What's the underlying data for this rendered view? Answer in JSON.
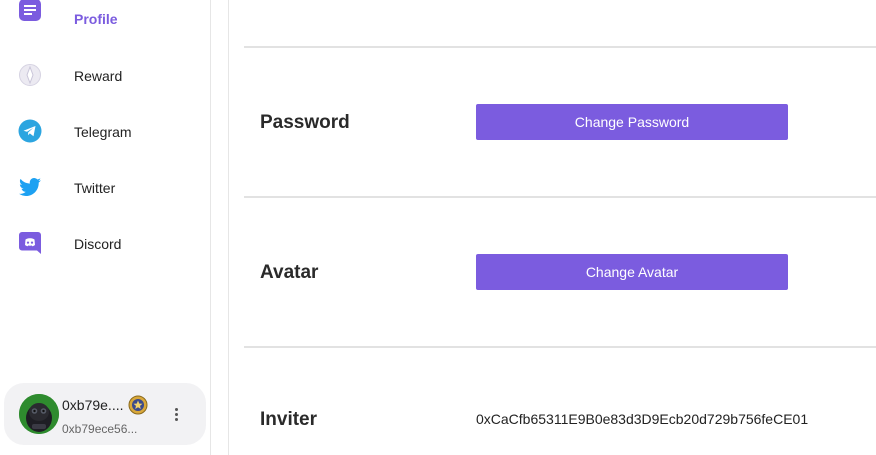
{
  "sidebar": {
    "items": [
      {
        "label": "Profile",
        "icon": "profile-icon",
        "active": true
      },
      {
        "label": "Reward",
        "icon": "reward-icon",
        "active": false
      },
      {
        "label": "Telegram",
        "icon": "telegram-icon",
        "active": false
      },
      {
        "label": "Twitter",
        "icon": "twitter-icon",
        "active": false
      },
      {
        "label": "Discord",
        "icon": "discord-icon",
        "active": false
      }
    ],
    "user": {
      "name": "0xb79e....",
      "address": "0xb79ece56..."
    }
  },
  "settings": {
    "password": {
      "label": "Password",
      "button": "Change Password"
    },
    "avatar": {
      "label": "Avatar",
      "button": "Change Avatar"
    },
    "inviter": {
      "label": "Inviter",
      "value": "0xCaCfb65311E9B0e83d3D9Ecb20d729b756feCE01"
    }
  },
  "colors": {
    "accent": "#7b5cdf",
    "telegram": "#2ca5e0",
    "twitter": "#1da1f2",
    "discord": "#7b5cdf"
  }
}
